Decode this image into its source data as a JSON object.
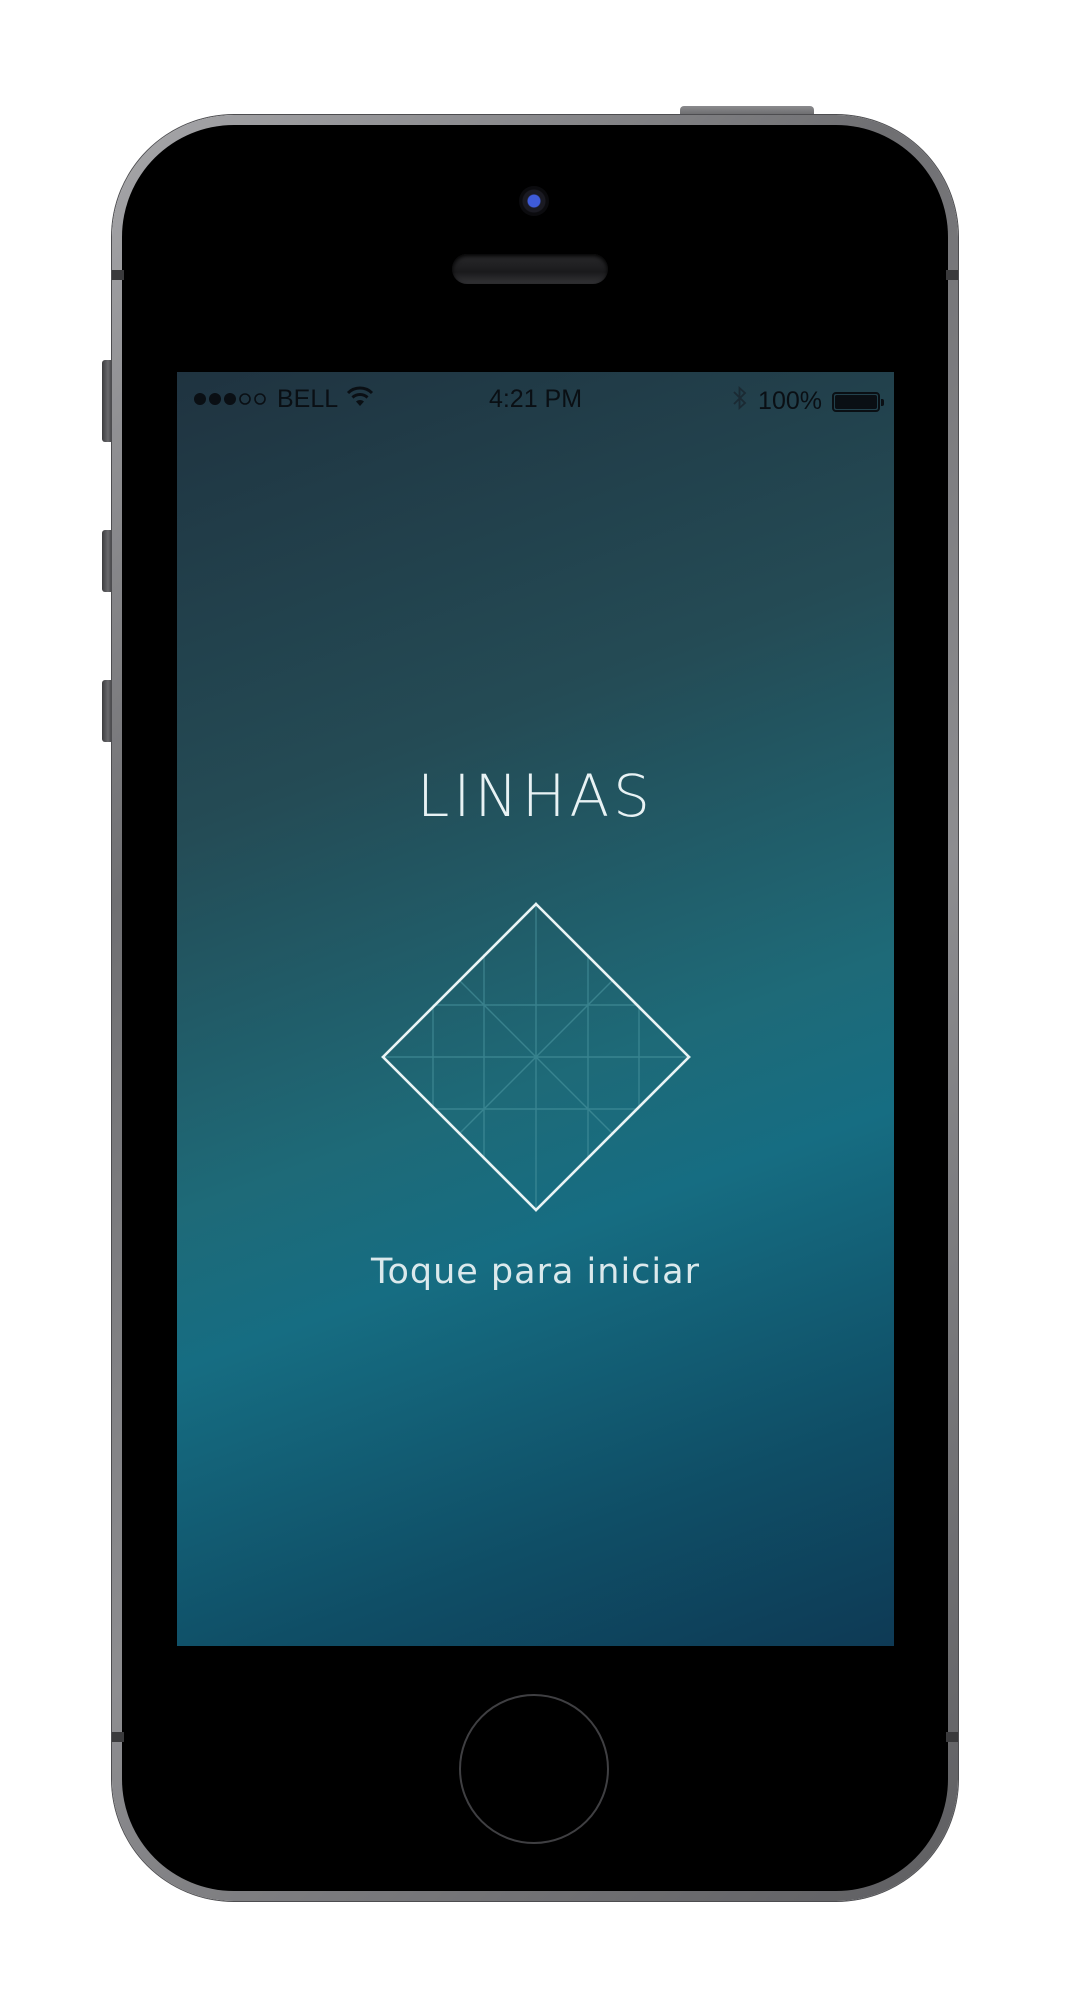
{
  "status_bar": {
    "carrier": "BELL",
    "signal_icon": "signal-dots-icon",
    "wifi_icon": "wifi-icon",
    "time": "4:21 PM",
    "bluetooth_icon": "bluetooth-icon",
    "battery_percent": "100%",
    "battery_level": 1.0,
    "battery_icon": "battery-icon"
  },
  "app": {
    "title": "LINHAS",
    "logo_icon": "diamond-grid-icon",
    "cta": "Toque para iniciar"
  },
  "colors": {
    "text_light": "#e8f2f4",
    "accent_teal": "#166d82",
    "status_text": "#0a0f14"
  }
}
